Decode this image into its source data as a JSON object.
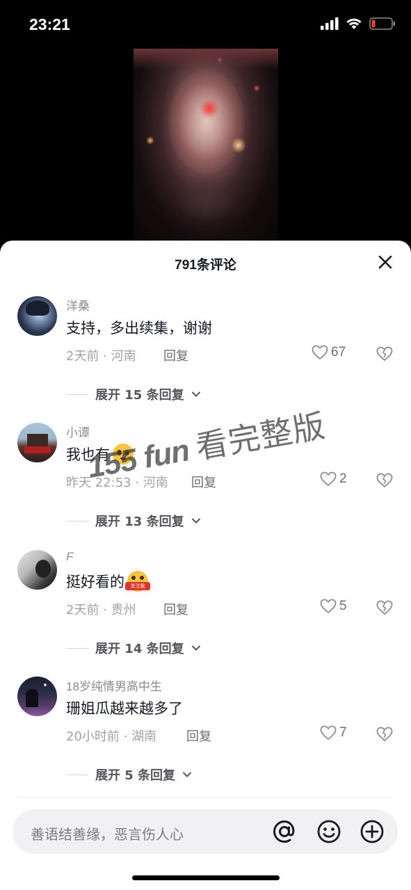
{
  "status_bar": {
    "time": "23:21"
  },
  "sheet": {
    "title": "791条评论"
  },
  "comments": [
    {
      "user": "洋桑",
      "text": "支持，多出续集，谢谢",
      "emoji": "",
      "meta": "2天前 · 河南",
      "reply": "回复",
      "likes": "67",
      "expand": "展开 15 条回复"
    },
    {
      "user": "小谭",
      "text": "我也有",
      "emoji": "pleading-face-emoji",
      "meta": "昨天 22:53 · 河南",
      "reply": "回复",
      "likes": "2",
      "expand": "展开 13 条回复"
    },
    {
      "user": "F",
      "text": "挺好看的",
      "emoji": "follow-me-sticker-emoji",
      "meta": "2天前 · 贵州",
      "reply": "回复",
      "likes": "5",
      "expand": "展开 14 条回复"
    },
    {
      "user": "18岁纯情男高中生",
      "text": "珊姐瓜越来越多了",
      "emoji": "",
      "meta": "20小时前 · 湖南",
      "reply": "回复",
      "likes": "7",
      "expand": "展开 5 条回复"
    }
  ],
  "emoji_sticker_text": "关注我",
  "input": {
    "placeholder": "善语结善缘，恶言伤人心"
  },
  "watermark": {
    "latin": "155 fun",
    "cjk": "看完整版"
  },
  "colors": {
    "sheet_bg": "#ffffff",
    "text_primary": "#161823",
    "text_secondary": "#8a8b91",
    "input_bg": "#f1f1f3"
  }
}
